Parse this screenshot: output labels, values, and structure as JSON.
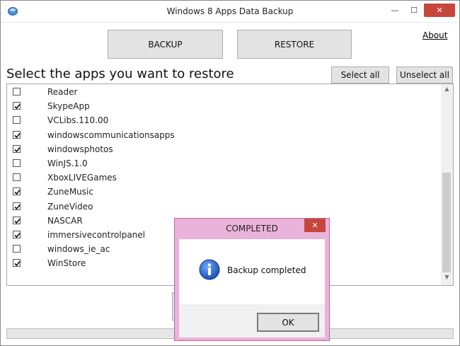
{
  "window": {
    "title": "Windows 8 Apps Data Backup",
    "min_glyph": "—",
    "max_glyph": "☐",
    "close_glyph": "✕"
  },
  "toolbar": {
    "backup_label": "BACKUP",
    "restore_label": "RESTORE",
    "about_label": "About"
  },
  "list_section": {
    "heading": "Select the apps you want to restore",
    "select_all_label": "Select all",
    "unselect_all_label": "Unselect all",
    "scroll_up_glyph": "▲",
    "scroll_down_glyph": "▼"
  },
  "apps": [
    {
      "label": "Reader",
      "checked": false
    },
    {
      "label": "SkypeApp",
      "checked": true
    },
    {
      "label": "VCLibs.110.00",
      "checked": false
    },
    {
      "label": "windowscommunicationsapps",
      "checked": true
    },
    {
      "label": "windowsphotos",
      "checked": true
    },
    {
      "label": "WinJS.1.0",
      "checked": false
    },
    {
      "label": "XboxLIVEGames",
      "checked": false
    },
    {
      "label": "ZuneMusic",
      "checked": true
    },
    {
      "label": "ZuneVideo",
      "checked": true
    },
    {
      "label": "NASCAR",
      "checked": true
    },
    {
      "label": "immersivecontrolpanel",
      "checked": true
    },
    {
      "label": "windows_ie_ac",
      "checked": false
    },
    {
      "label": "WinStore",
      "checked": true
    }
  ],
  "dialog": {
    "title": "COMPLETED",
    "close_glyph": "✕",
    "message": "Backup completed",
    "ok_label": "OK"
  },
  "colors": {
    "accent_close": "#c7463b",
    "dialog_frame": "#eab3d9",
    "info_blue": "#1f5fc7"
  }
}
